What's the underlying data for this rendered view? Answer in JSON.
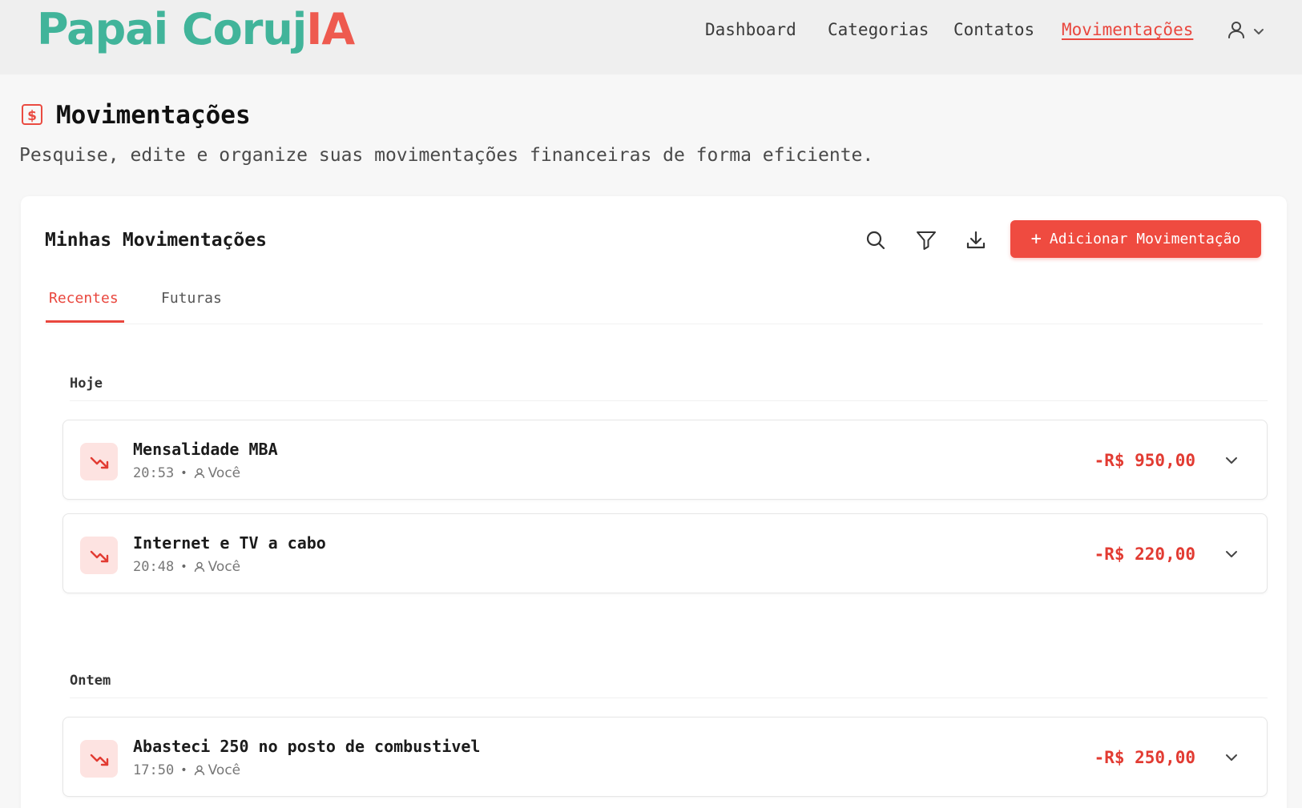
{
  "header": {
    "logo_part1": "Papai Coruj",
    "logo_part2": "IA",
    "nav": [
      "Dashboard",
      "Categorias",
      "Contatos",
      "Movimentações"
    ],
    "active_nav": "Movimentações"
  },
  "page": {
    "title": "Movimentações",
    "subtitle": "Pesquise, edite e organize suas movimentações financeiras de forma eficiente."
  },
  "card": {
    "title": "Minhas Movimentações",
    "add_button_label": "Adicionar Movimentação",
    "tabs": [
      "Recentes",
      "Futuras"
    ],
    "active_tab": "Recentes"
  },
  "groups": [
    {
      "label": "Hoje",
      "items": [
        {
          "title": "Mensalidade MBA",
          "time": "20:53",
          "who": "Você",
          "amount": "-R$ 950,00"
        },
        {
          "title": "Internet e TV a cabo",
          "time": "20:48",
          "who": "Você",
          "amount": "-R$ 220,00"
        }
      ]
    },
    {
      "label": "Ontem",
      "items": [
        {
          "title": "Abasteci 250 no posto de combustivel",
          "time": "17:50",
          "who": "Você",
          "amount": "-R$ 250,00"
        }
      ]
    }
  ],
  "icons": {
    "page": "dollar-sign-icon",
    "search": "search-icon",
    "filter": "filter-icon",
    "download": "download-icon",
    "user": "user-icon",
    "chevron": "chevron-down-icon",
    "trend": "trending-down-icon"
  },
  "colors": {
    "brand_green": "#41b49a",
    "brand_red": "#ee5a4f",
    "accent": "#ef4b40",
    "expense": "#e23b32"
  }
}
